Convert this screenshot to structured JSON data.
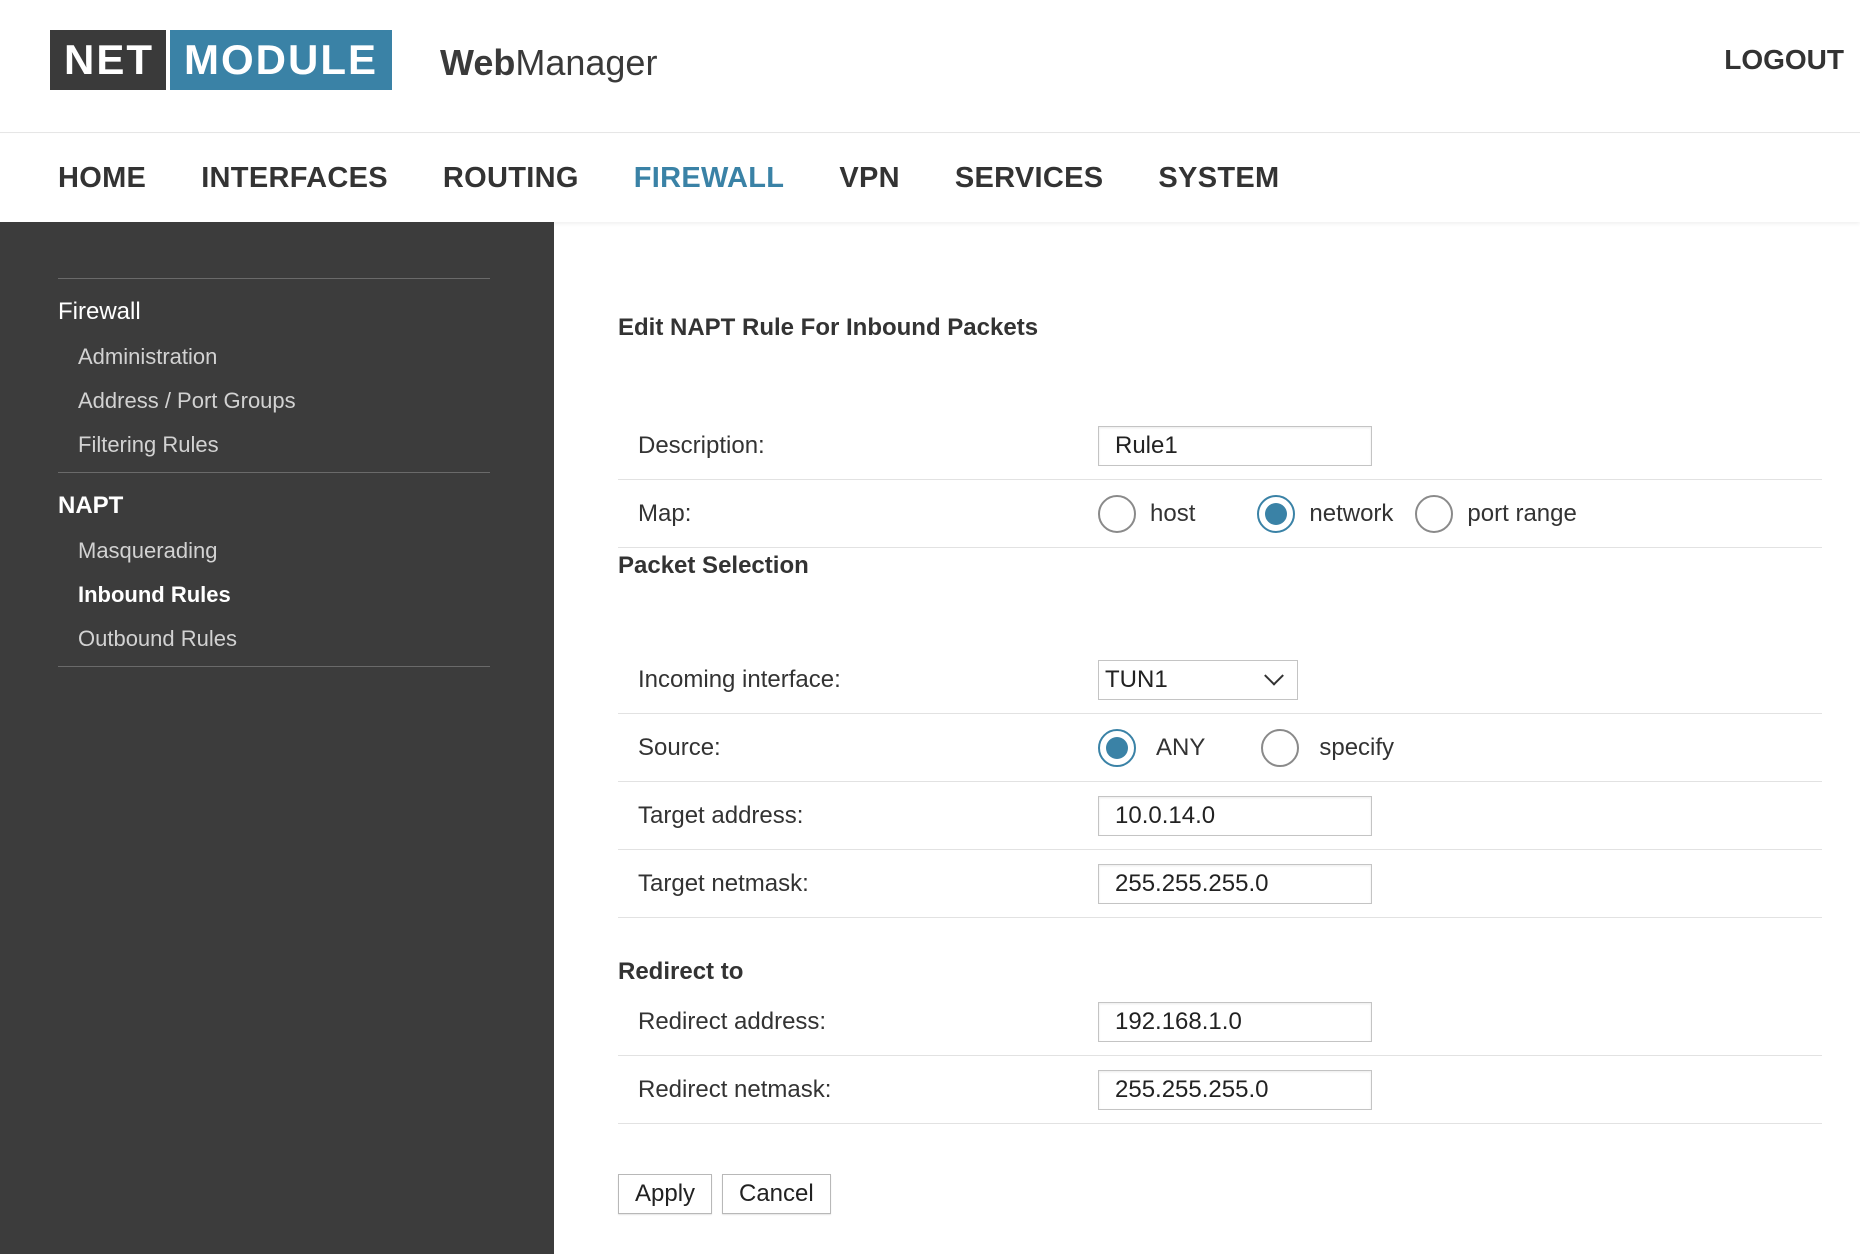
{
  "header": {
    "logo_net": "NET",
    "logo_module": "MODULE",
    "app_name_bold": "Web",
    "app_name_light": "Manager",
    "logout_label": "LOGOUT"
  },
  "main_nav": {
    "items": [
      "HOME",
      "INTERFACES",
      "ROUTING",
      "FIREWALL",
      "VPN",
      "SERVICES",
      "SYSTEM"
    ],
    "active": "FIREWALL"
  },
  "sidebar": {
    "group_firewall": "Firewall",
    "firewall_items": [
      "Administration",
      "Address / Port Groups",
      "Filtering Rules"
    ],
    "group_napt": "NAPT",
    "napt_items": [
      "Masquerading",
      "Inbound Rules",
      "Outbound Rules"
    ],
    "active_item": "Inbound Rules"
  },
  "form": {
    "title": "Edit NAPT Rule For Inbound Packets",
    "description_label": "Description:",
    "description_value": "Rule1",
    "map_label": "Map:",
    "map_options": [
      "host",
      "network",
      "port range"
    ],
    "map_selected": "network",
    "packet_selection_title": "Packet Selection",
    "incoming_interface_label": "Incoming interface:",
    "incoming_interface_value": "TUN1",
    "source_label": "Source:",
    "source_options": [
      "ANY",
      "specify"
    ],
    "source_selected": "ANY",
    "target_address_label": "Target address:",
    "target_address_value": "10.0.14.0",
    "target_netmask_label": "Target netmask:",
    "target_netmask_value": "255.255.255.0",
    "redirect_title": "Redirect to",
    "redirect_address_label": "Redirect address:",
    "redirect_address_value": "192.168.1.0",
    "redirect_netmask_label": "Redirect netmask:",
    "redirect_netmask_value": "255.255.255.0",
    "apply_label": "Apply",
    "cancel_label": "Cancel"
  },
  "colors": {
    "accent": "#3a82a6",
    "logo_dark": "#3a3a3a",
    "sidebar_bg": "#3c3c3c"
  }
}
